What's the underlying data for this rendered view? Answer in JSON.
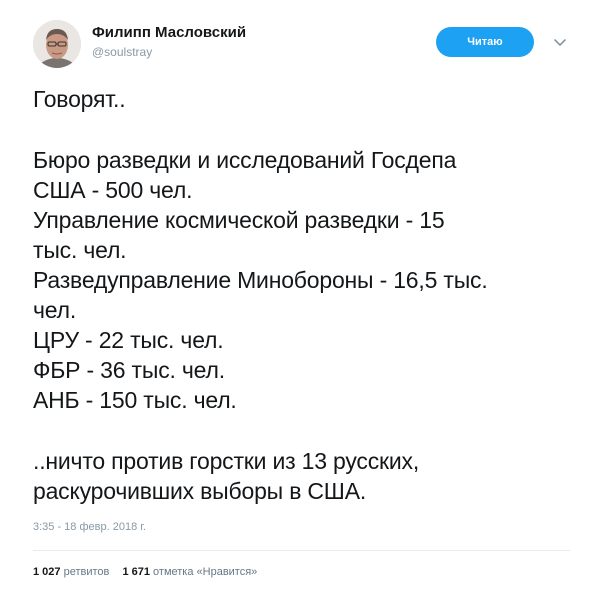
{
  "author": {
    "name": "Филипп Масловский",
    "handle": "@soulstray"
  },
  "header": {
    "follow_label": "Читаю"
  },
  "tweet": {
    "lines": [
      "Говорят..",
      "",
      "Бюро разведки и исследований Госдепа",
      "США - 500 чел.",
      "Управление космической разведки - 15",
      "тыс. чел.",
      "Разведуправление Минобороны - 16,5 тыс.",
      "чел.",
      "ЦРУ - 22 тыс. чел.",
      "ФБР - 36 тыс. чел.",
      "АНБ - 150 тыс. чел.",
      "",
      "..ничто против горстки из 13 русских,",
      "раскурочивших выборы в США."
    ],
    "timestamp": "3:35 - 18 февр. 2018 г."
  },
  "stats": {
    "retweets_count": "1 027",
    "retweets_label": "ретвитов",
    "likes_count": "1 671",
    "likes_label": "отметка «Нравится»"
  },
  "colors": {
    "accent": "#1da1f2",
    "text": "#14171a",
    "muted": "#8899a6"
  }
}
